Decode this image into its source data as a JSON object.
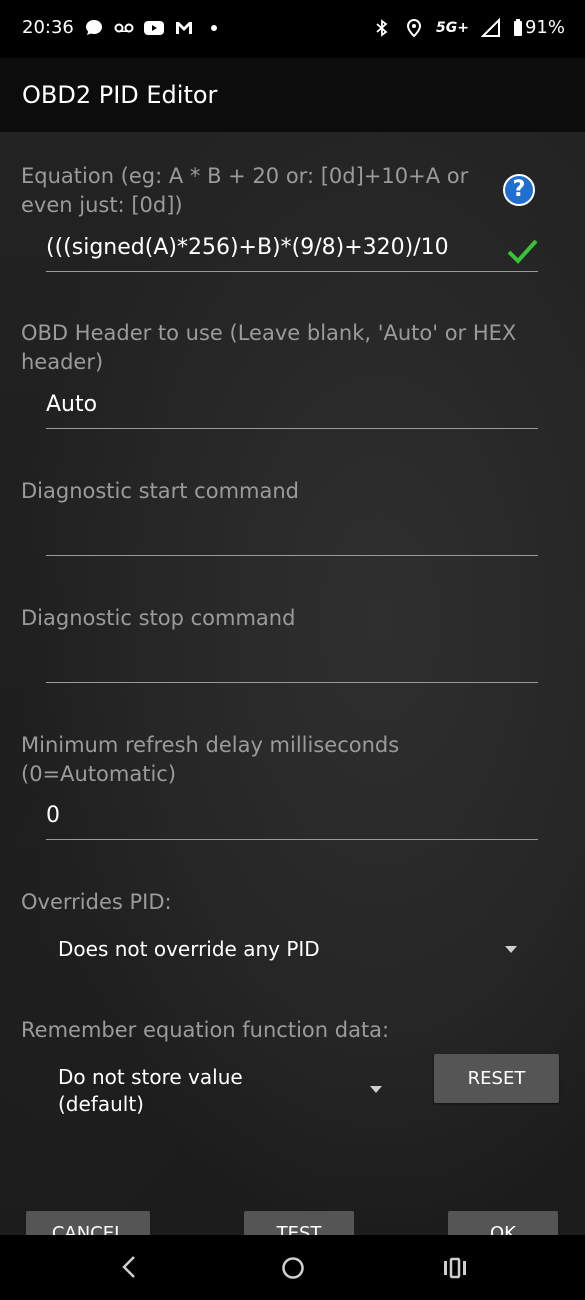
{
  "status_bar": {
    "time": "20:36",
    "network": "5G+",
    "battery": "91%"
  },
  "app_bar": {
    "title": "OBD2 PID Editor"
  },
  "form": {
    "equation": {
      "label": "Equation (eg:  A * B + 20   or: [0d]+10+A  or even just: [0d])",
      "value": "(((signed(A)*256)+B)*(9/8)+320)/10"
    },
    "header": {
      "label": "OBD Header to use (Leave blank, 'Auto' or HEX header)",
      "value": "Auto"
    },
    "diag_start": {
      "label": "Diagnostic start command",
      "value": ""
    },
    "diag_stop": {
      "label": "Diagnostic stop command",
      "value": ""
    },
    "refresh": {
      "label": "Minimum refresh delay milliseconds (0=Automatic)",
      "value": "0"
    },
    "overrides": {
      "label": "Overrides PID:",
      "selected": "Does not override any PID"
    },
    "remember": {
      "label": "Remember equation function data:",
      "selected": "Do not store value (default)",
      "reset_label": "RESET"
    }
  },
  "buttons": {
    "cancel": "CANCEL",
    "test": "TEST",
    "ok": "OK"
  },
  "colors": {
    "accent": "#1e6fd0",
    "check": "#3ac23a",
    "button": "#555555"
  }
}
